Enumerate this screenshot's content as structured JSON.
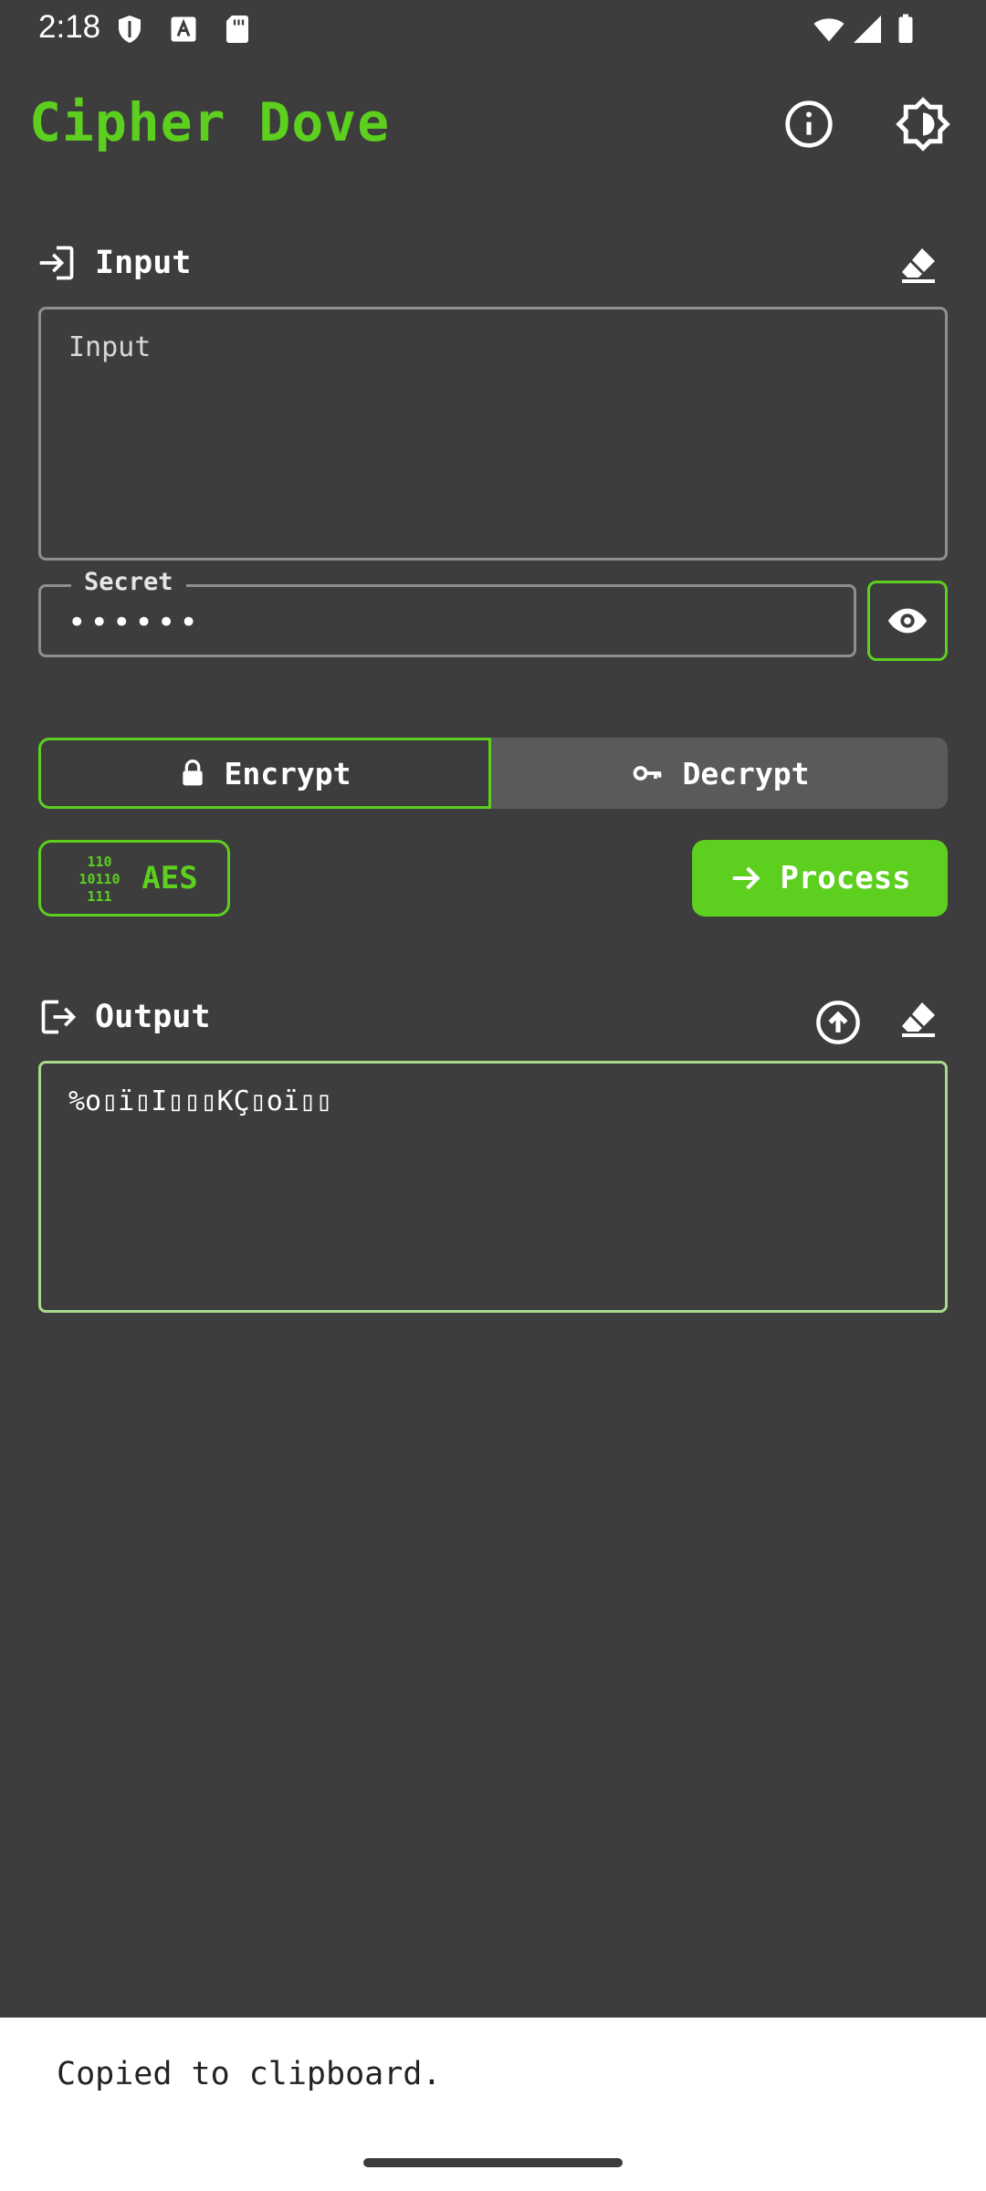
{
  "status_bar": {
    "time": "2:18"
  },
  "app_bar": {
    "title": "Cipher Dove",
    "info_icon": "info-icon",
    "theme_icon": "brightness-icon"
  },
  "input_section": {
    "label": "Input",
    "placeholder": "Input",
    "value": ""
  },
  "secret": {
    "label": "Secret",
    "value": "••••••"
  },
  "mode": {
    "encrypt_label": "Encrypt",
    "decrypt_label": "Decrypt",
    "selected": "Encrypt"
  },
  "algorithm": {
    "label": "AES"
  },
  "process": {
    "label": "Process"
  },
  "output_section": {
    "label": "Output",
    "value": "%o▯ï▯I▯▯▯KÇ▯oï▯▯"
  },
  "snackbar": {
    "message": "Copied to clipboard."
  },
  "colors": {
    "accent": "#5ccf1f",
    "background": "#3d3d3d",
    "segment_unselected": "#5a5a5a"
  }
}
